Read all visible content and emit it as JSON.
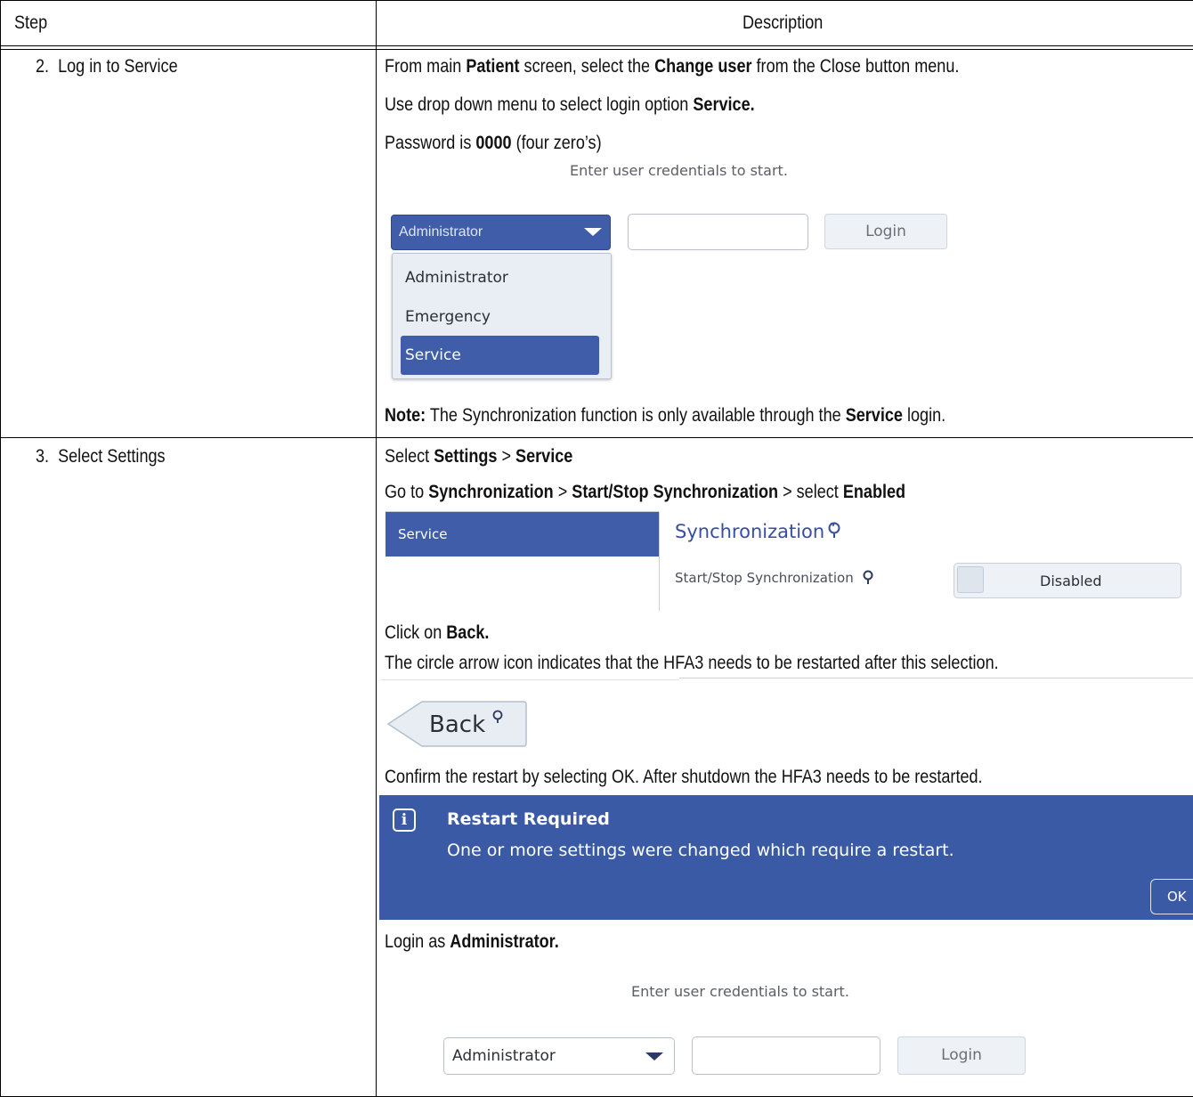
{
  "header": {
    "step": "Step",
    "description": "Description"
  },
  "row2": {
    "step": "2.  Log in to Service",
    "line1": [
      "From main ",
      "Patient",
      " screen, select the ",
      "Change user",
      " from the Close button menu."
    ],
    "line2": [
      "Use drop down menu to select login option ",
      "Service."
    ],
    "line3": [
      "Password is ",
      "0000",
      " (four zero’s)"
    ],
    "login": {
      "hint": "Enter user credentials to start.",
      "selected": "Administrator",
      "button": "Login",
      "options": [
        "Administrator",
        "Emergency",
        "Service"
      ]
    },
    "note": [
      "Note:",
      " The Synchronization function is only available through the ",
      "Service",
      " login."
    ]
  },
  "row3": {
    "step": "3.  Select Settings",
    "line1": [
      "Select ",
      "Settings",
      " > ",
      "Service"
    ],
    "line2": [
      "Go to ",
      "Synchronization",
      " > ",
      "Start/Stop Synchronization",
      " > select ",
      "Enabled"
    ],
    "settings": {
      "tab": "Service",
      "title": "Synchronization",
      "row_label": "Start/Stop Synchronization",
      "toggle_value": "Disabled"
    },
    "line3": [
      "Click on ",
      "Back."
    ],
    "line4": "The circle arrow icon indicates that the HFA3 needs to be restarted after this selection.",
    "back_label": "Back",
    "line5": "Confirm the restart by selecting OK. After shutdown the HFA3 needs to be restarted.",
    "dialog": {
      "icon": "i",
      "title": "Restart Required",
      "message": "One or more settings were changed which require a restart.",
      "ok": "OK"
    },
    "line6": [
      "Login as ",
      "Administrator."
    ],
    "login2": {
      "hint": "Enter user credentials to start.",
      "selected": "Administrator",
      "button": "Login"
    }
  }
}
